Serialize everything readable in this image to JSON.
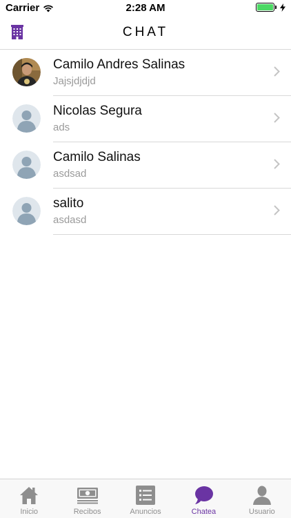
{
  "status_bar": {
    "carrier": "Carrier",
    "time": "2:28 AM"
  },
  "nav": {
    "title": "CHAT",
    "left_icon": "building-icon",
    "accent_color": "#6a34a3"
  },
  "chats": [
    {
      "name": "Camilo Andres Salinas",
      "preview": "Jajsjdjdjd",
      "avatar": "photo"
    },
    {
      "name": "Nicolas Segura",
      "preview": "ads",
      "avatar": "placeholder"
    },
    {
      "name": "Camilo Salinas",
      "preview": "asdsad",
      "avatar": "placeholder"
    },
    {
      "name": "salito",
      "preview": "asdasd",
      "avatar": "placeholder"
    }
  ],
  "tabs": [
    {
      "label": "Inicio",
      "icon": "home-icon",
      "active": false
    },
    {
      "label": "Recibos",
      "icon": "money-icon",
      "active": false
    },
    {
      "label": "Anuncios",
      "icon": "list-icon",
      "active": false
    },
    {
      "label": "Chatea",
      "icon": "chat-bubble-icon",
      "active": true
    },
    {
      "label": "Usuario",
      "icon": "user-icon",
      "active": false
    }
  ]
}
